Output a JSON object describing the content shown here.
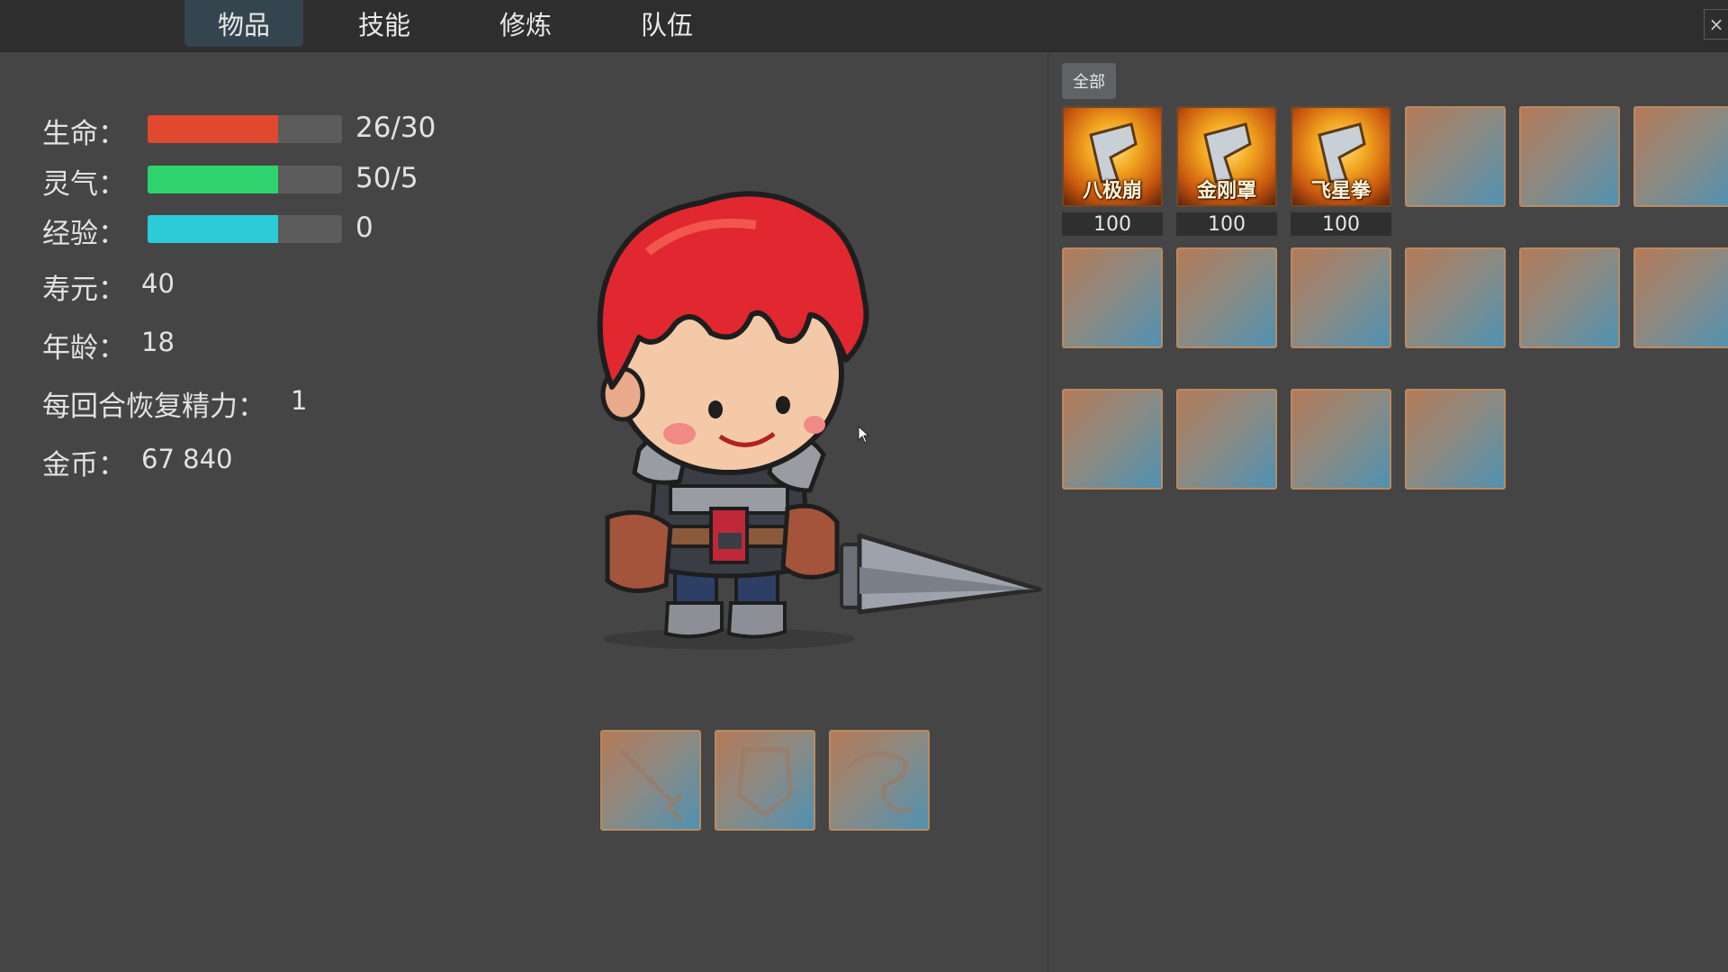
{
  "tabs": [
    {
      "label": "物品",
      "active": true
    },
    {
      "label": "技能",
      "active": false
    },
    {
      "label": "修炼",
      "active": false
    },
    {
      "label": "队伍",
      "active": false
    }
  ],
  "close_symbol": "×",
  "stats": {
    "hp": {
      "label": "生命：",
      "value": "26/30",
      "fill_fraction": 0.67,
      "color": "#e0492f"
    },
    "qi": {
      "label": "灵气：",
      "value": "50/5",
      "fill_fraction": 0.67,
      "color": "#2ed36e"
    },
    "exp": {
      "label": "经验：",
      "value": "0",
      "fill_fraction": 0.67,
      "color": "#2ccbd8"
    }
  },
  "info": {
    "lifespan": {
      "label": "寿元：",
      "value": "40"
    },
    "age": {
      "label": "年龄：",
      "value": "18"
    },
    "energy_regen": {
      "label": "每回合恢复精力：",
      "value": "1"
    },
    "gold": {
      "label": "金币：",
      "value": "67 840"
    }
  },
  "inventory": {
    "filter_label": "全部",
    "items": [
      {
        "name": "八极崩",
        "count": "100",
        "icon": "fist-skill-icon"
      },
      {
        "name": "金刚罩",
        "count": "100",
        "icon": "fist-skill-icon"
      },
      {
        "name": "飞星拳",
        "count": "100",
        "icon": "fist-skill-icon"
      }
    ]
  },
  "equipment_slots": [
    {
      "icon": "sword-slot-icon"
    },
    {
      "icon": "armor-slot-icon"
    },
    {
      "icon": "accessory-slot-icon"
    }
  ]
}
